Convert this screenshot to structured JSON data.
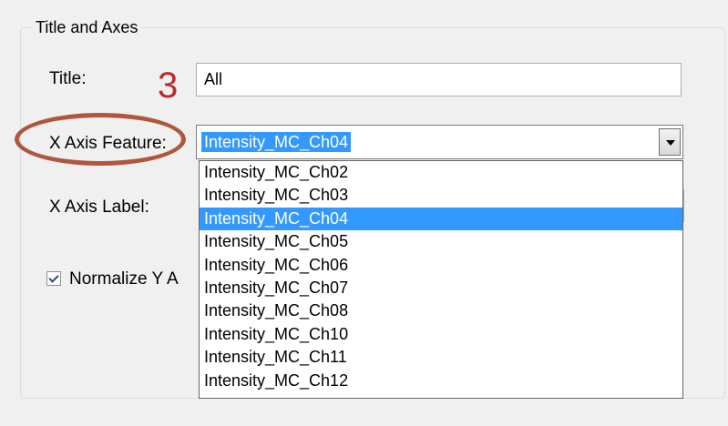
{
  "group": {
    "title": "Title and Axes"
  },
  "title_field": {
    "label": "Title:",
    "value": "All"
  },
  "annotation": {
    "number": "3",
    "color": "#c0282a",
    "ellipse_color": "#b0563e"
  },
  "x_axis_feature": {
    "label": "X Axis Feature:",
    "selected": "Intensity_MC_Ch04",
    "options": [
      "Intensity_MC_Ch02",
      "Intensity_MC_Ch03",
      "Intensity_MC_Ch04",
      "Intensity_MC_Ch05",
      "Intensity_MC_Ch06",
      "Intensity_MC_Ch07",
      "Intensity_MC_Ch08",
      "Intensity_MC_Ch10",
      "Intensity_MC_Ch11",
      "Intensity_MC_Ch12"
    ],
    "highlighted_index": 2
  },
  "x_axis_label": {
    "label": "X Axis Label:"
  },
  "normalize": {
    "label": "Normalize Y A",
    "checked": true
  },
  "colors": {
    "selection": "#3399ff",
    "background": "#f0f0f0"
  }
}
